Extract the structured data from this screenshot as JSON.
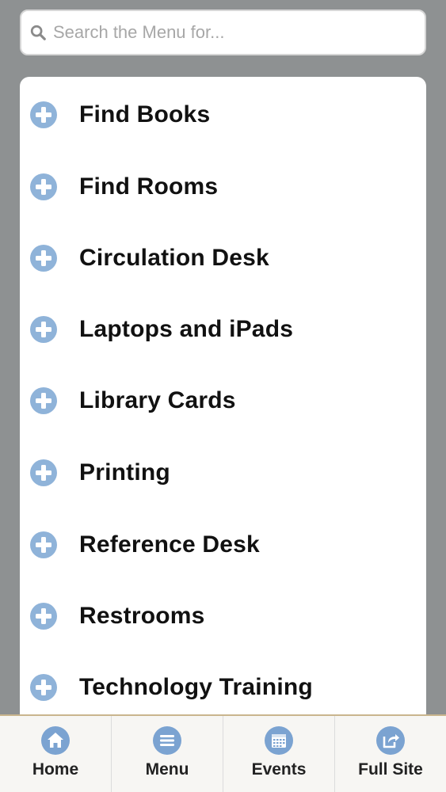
{
  "search": {
    "placeholder": "Search the Menu for..."
  },
  "menu": {
    "items": [
      {
        "label": "Find Books"
      },
      {
        "label": "Find Rooms"
      },
      {
        "label": "Circulation Desk"
      },
      {
        "label": "Laptops and iPads"
      },
      {
        "label": "Library Cards"
      },
      {
        "label": "Printing"
      },
      {
        "label": "Reference Desk"
      },
      {
        "label": "Restrooms"
      },
      {
        "label": "Technology Training"
      }
    ]
  },
  "tabs": {
    "home": "Home",
    "menu": "Menu",
    "events": "Events",
    "full_site": "Full Site"
  },
  "colors": {
    "background": "#8e9192",
    "icon_fill": "#8fb3d9",
    "text": "#111111"
  }
}
